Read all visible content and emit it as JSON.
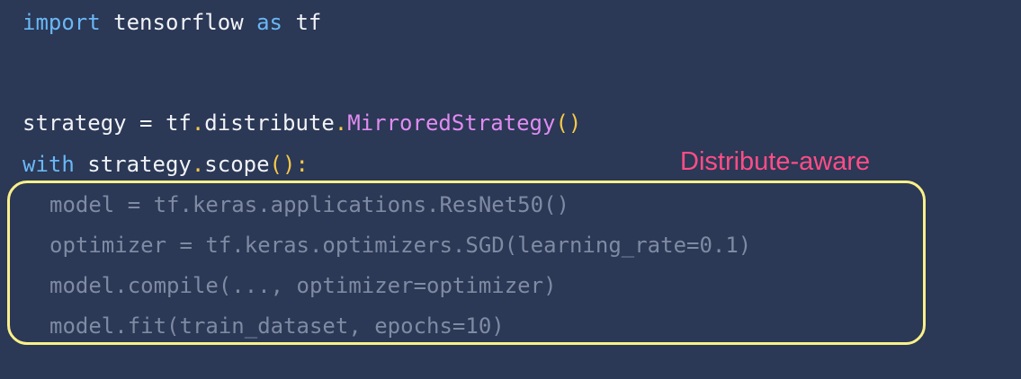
{
  "code": {
    "line1": {
      "kw_import": "import",
      "module": " tensorflow ",
      "kw_as": "as",
      "alias": " tf"
    },
    "line2": {
      "lhs": "strategy = tf",
      "dot1": ".",
      "mid": "distribute",
      "dot2": ".",
      "cls": "MirroredStrategy",
      "parens": "()"
    },
    "line3": {
      "kw_with": "with",
      "obj": " strategy",
      "dot": ".",
      "method": "scope",
      "parens": "()",
      "colon": ":"
    },
    "line4": "model = tf.keras.applications.ResNet50()",
    "line5": "optimizer = tf.keras.optimizers.SGD(learning_rate=0.1)",
    "line6": "model.compile(..., optimizer=optimizer)",
    "line7": "model.fit(train_dataset, epochs=10)"
  },
  "annotation": {
    "label": "Distribute-aware",
    "box_color": "#fbf089",
    "label_color": "#ff4d86"
  },
  "theme": {
    "background": "#2b3856",
    "keyword": "#69b8f5",
    "punctuation": "#f7c948",
    "class_name": "#e08cf0",
    "text": "#f1f3f7",
    "faded_text": "#7f8ba3"
  }
}
